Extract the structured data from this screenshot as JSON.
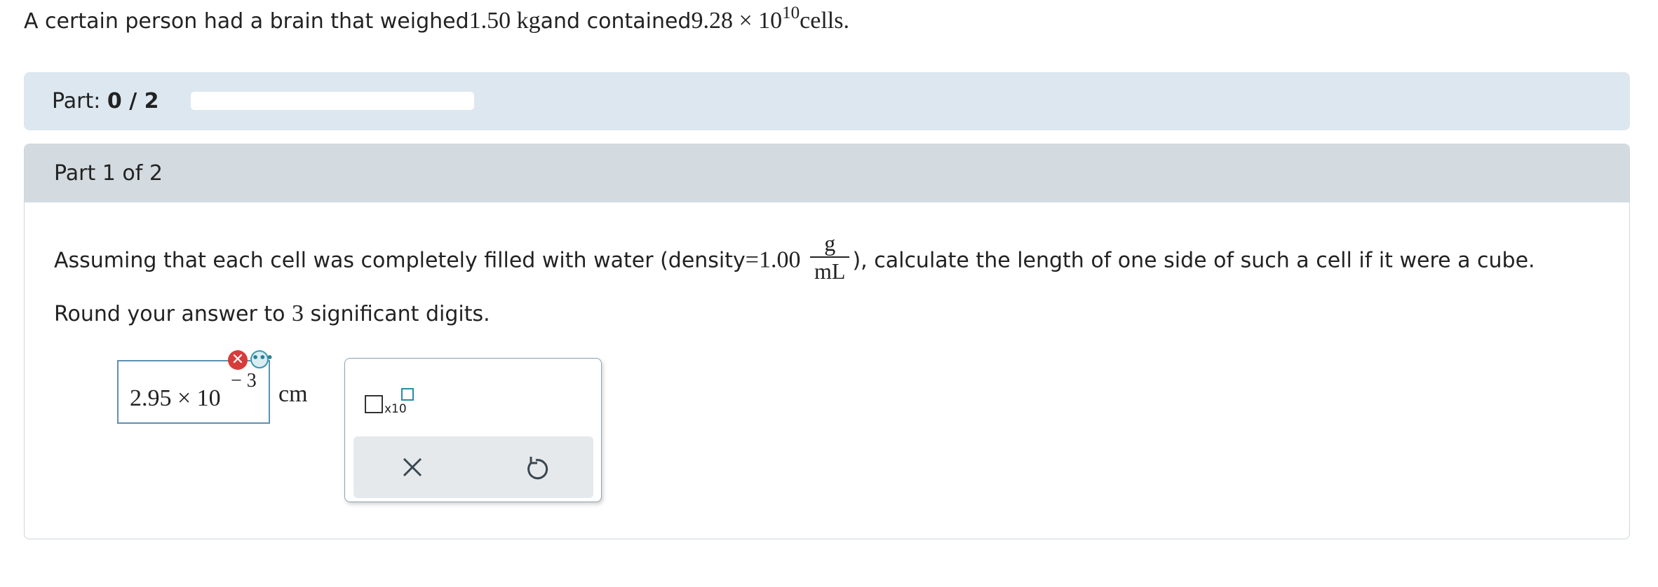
{
  "intro": {
    "text_before": "A certain person had a brain that weighed ",
    "mass": "1.50 kg",
    "text_mid": " and contained ",
    "cells_base": "9.28 × 10",
    "cells_exp": "10",
    "text_after": " cells."
  },
  "part_bar": {
    "label": "Part:",
    "progress": "0 / 2",
    "progress_fraction": 0
  },
  "part": {
    "header": "Part 1 of 2",
    "question_before": "Assuming that each cell was completely filled with water (density",
    "density_value": "=1.00",
    "unit_num": "g",
    "unit_den": "mL",
    "question_after": "), calculate the length of one side of such a cell if it were a cube. Round your answer to ",
    "sig_figs": "3",
    "question_end": " significant digits."
  },
  "answer": {
    "mantissa": "2.95 × 10",
    "exponent": "− 3",
    "unit": "cm",
    "status": "incorrect",
    "error_icon": "x-circle-icon",
    "feedback_icon": "more-dots-icon"
  },
  "tools": {
    "x10_label": "x10",
    "clear_icon": "close-icon",
    "undo_icon": "undo-icon"
  },
  "colors": {
    "part_bar_bg": "#dde7ef",
    "part_header_bg": "#d4dbe0",
    "error_red": "#d93b3b",
    "accent_teal": "#2b8aa8"
  }
}
